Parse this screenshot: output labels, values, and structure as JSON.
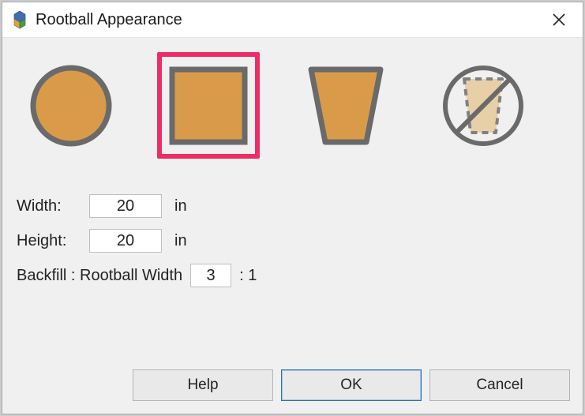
{
  "window": {
    "title": "Rootball Appearance"
  },
  "shapes": {
    "options": [
      {
        "id": "circle",
        "name": "shape-circle-option"
      },
      {
        "id": "square",
        "name": "shape-square-option"
      },
      {
        "id": "tapered",
        "name": "shape-tapered-option"
      },
      {
        "id": "none",
        "name": "shape-none-option"
      }
    ],
    "selected": "square"
  },
  "fields": {
    "width": {
      "label": "Width:",
      "value": "20",
      "unit": "in"
    },
    "height": {
      "label": "Height:",
      "value": "20",
      "unit": "in"
    },
    "ratio": {
      "label": "Backfill : Rootball Width",
      "value": "3",
      "suffix": ": 1"
    }
  },
  "buttons": {
    "help": "Help",
    "ok": "OK",
    "cancel": "Cancel"
  },
  "colors": {
    "fill": "#d99b4a",
    "stroke": "#6a6a6a",
    "accent": "#ef2c63"
  }
}
